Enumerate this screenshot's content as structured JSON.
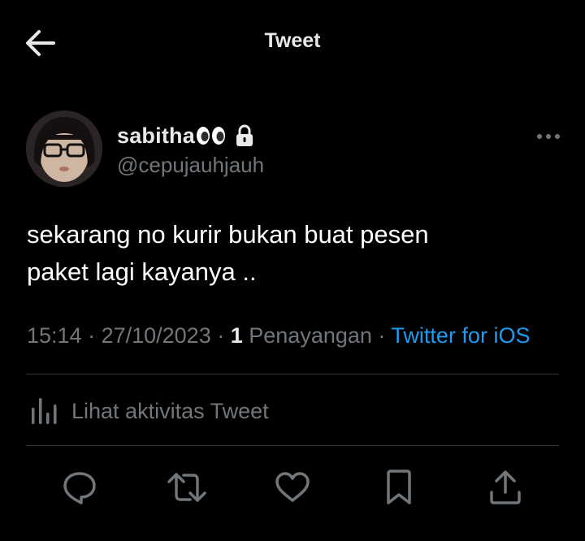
{
  "header": {
    "title": "Tweet",
    "back_icon": "arrow-left-icon"
  },
  "tweet": {
    "author": {
      "display_name": "sabitha",
      "emoji": "👀",
      "protected_icon": "lock-icon",
      "handle": "@cepujauhjauh"
    },
    "more_icon": "more-horizontal-icon",
    "text": "sekarang no kurir bukan buat pesen\npaket lagi kayanya ..",
    "time": "15:14",
    "date": "27/10/2023",
    "views_count": "1",
    "views_label": "Penayangan",
    "source": "Twitter for iOS",
    "separator": " · "
  },
  "activity": {
    "label": "Lihat aktivitas Tweet",
    "icon": "analytics-icon"
  },
  "actions": [
    {
      "name": "reply",
      "icon": "reply-icon"
    },
    {
      "name": "retweet",
      "icon": "retweet-icon"
    },
    {
      "name": "like",
      "icon": "heart-icon"
    },
    {
      "name": "bookmark",
      "icon": "bookmark-icon"
    },
    {
      "name": "share",
      "icon": "share-icon"
    }
  ],
  "colors": {
    "background": "#000000",
    "text": "#e7e9ea",
    "secondary_text": "#71767b",
    "link": "#1d9bf0",
    "divider": "#2f3336"
  }
}
